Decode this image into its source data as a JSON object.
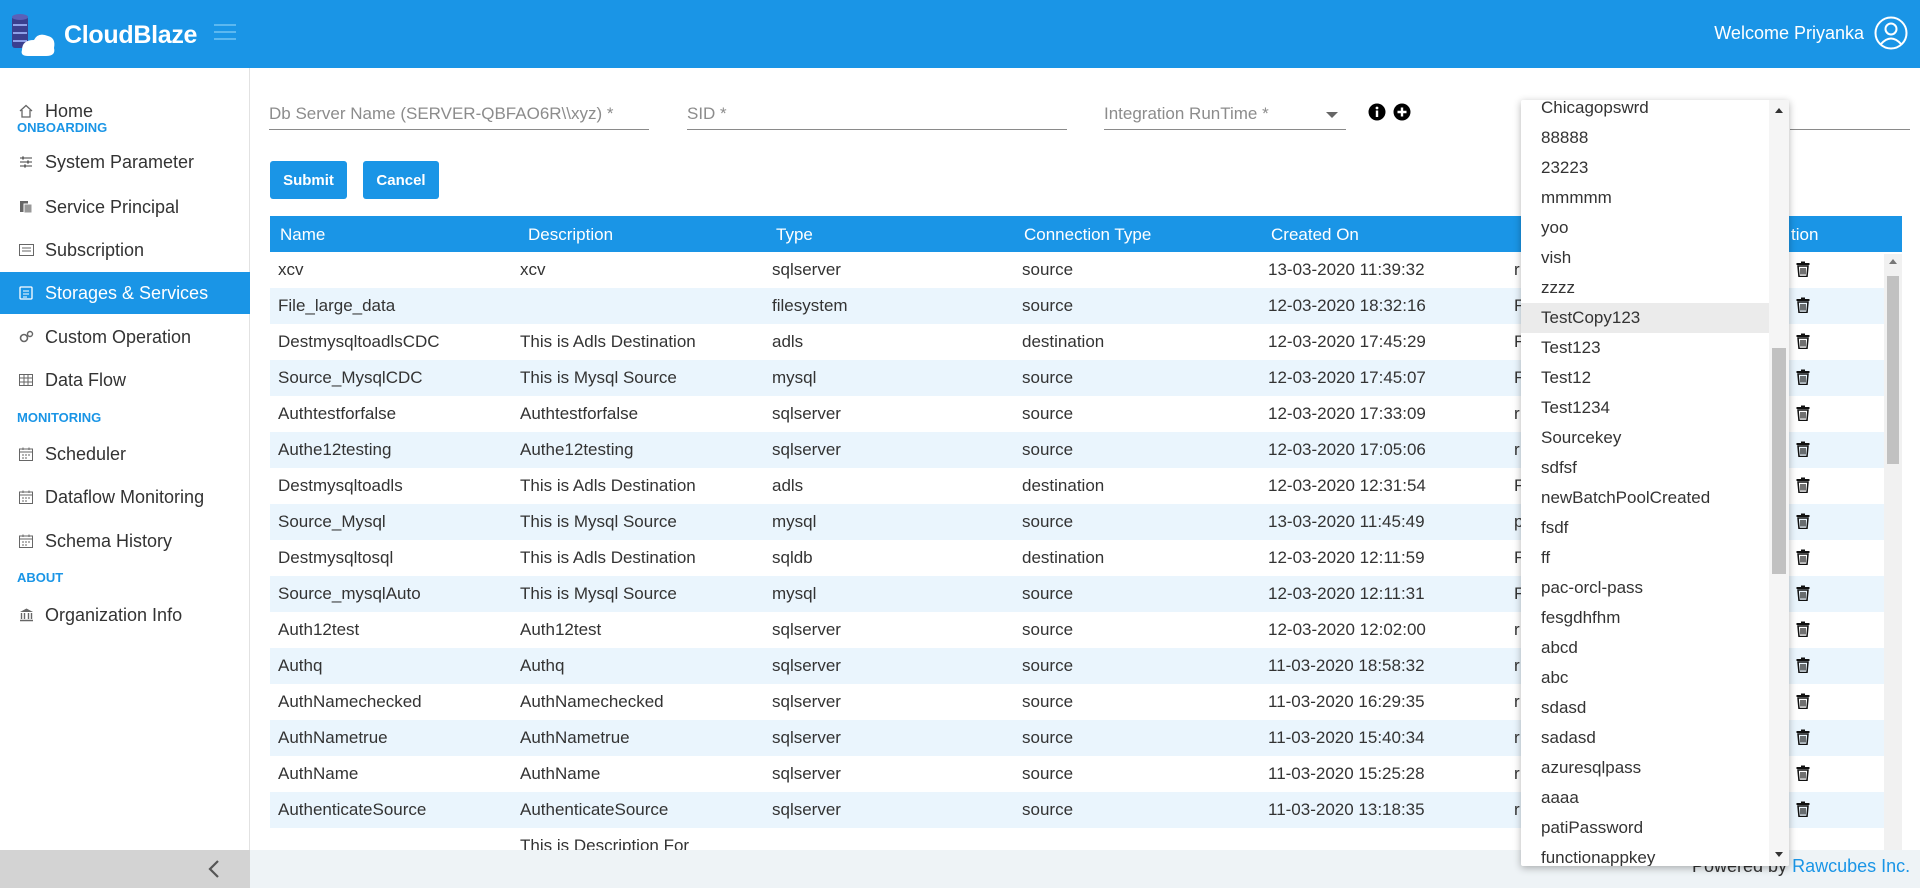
{
  "header": {
    "brand": "CloudBlaze",
    "welcome": "Welcome Priyanka"
  },
  "colors": {
    "accent": "#1a95e6",
    "row_alt": "#eaf5fd"
  },
  "sidebar": {
    "home": "Home",
    "onboarding": "ONBOARDING",
    "system_parameter": "System Parameter",
    "service_principal": "Service Principal",
    "subscription": "Subscription",
    "storages_services": "Storages & Services",
    "custom_operation": "Custom Operation",
    "data_flow": "Data Flow",
    "monitoring": "MONITORING",
    "scheduler": "Scheduler",
    "dataflow_monitoring": "Dataflow Monitoring",
    "schema_history": "Schema History",
    "about": "ABOUT",
    "organization_info": "Organization Info"
  },
  "form": {
    "server_placeholder": "Db Server Name (SERVER-QBFAO6R\\\\xyz) *",
    "sid_placeholder": "SID *",
    "runtime_placeholder": "Integration RunTime *",
    "submit": "Submit",
    "cancel": "Cancel"
  },
  "table": {
    "headers": {
      "name": "Name",
      "description": "Description",
      "type": "Type",
      "connection_type": "Connection Type",
      "created_on": "Created On",
      "action": "tion"
    },
    "rows": [
      {
        "name": "xcv",
        "description": "xcv",
        "type": "sqlserver",
        "conn": "source",
        "created": "13-03-2020 11:39:32",
        "extra": "r"
      },
      {
        "name": "File_large_data",
        "description": "",
        "type": "filesystem",
        "conn": "source",
        "created": "12-03-2020 18:32:16",
        "extra": "F"
      },
      {
        "name": "DestmysqltoadlsCDC",
        "description": "This is Adls Destination",
        "type": "adls",
        "conn": "destination",
        "created": "12-03-2020 17:45:29",
        "extra": "F"
      },
      {
        "name": "Source_MysqlCDC",
        "description": "This is Mysql Source",
        "type": "mysql",
        "conn": "source",
        "created": "12-03-2020 17:45:07",
        "extra": "F"
      },
      {
        "name": "Authtestforfalse",
        "description": "Authtestforfalse",
        "type": "sqlserver",
        "conn": "source",
        "created": "12-03-2020 17:33:09",
        "extra": "r"
      },
      {
        "name": "Authe12testing",
        "description": "Authe12testing",
        "type": "sqlserver",
        "conn": "source",
        "created": "12-03-2020 17:05:06",
        "extra": "r"
      },
      {
        "name": "Destmysqltoadls",
        "description": "This is Adls Destination",
        "type": "adls",
        "conn": "destination",
        "created": "12-03-2020 12:31:54",
        "extra": "F"
      },
      {
        "name": "Source_Mysql",
        "description": "This is Mysql Source",
        "type": "mysql",
        "conn": "source",
        "created": "13-03-2020 11:45:49",
        "extra": "p"
      },
      {
        "name": "Destmysqltosql",
        "description": "This is Adls Destination",
        "type": "sqldb",
        "conn": "destination",
        "created": "12-03-2020 12:11:59",
        "extra": "F"
      },
      {
        "name": "Source_mysqlAuto",
        "description": "This is Mysql Source",
        "type": "mysql",
        "conn": "source",
        "created": "12-03-2020 12:11:31",
        "extra": "F"
      },
      {
        "name": "Auth12test",
        "description": "Auth12test",
        "type": "sqlserver",
        "conn": "source",
        "created": "12-03-2020 12:02:00",
        "extra": "r"
      },
      {
        "name": "Authq",
        "description": "Authq",
        "type": "sqlserver",
        "conn": "source",
        "created": "11-03-2020 18:58:32",
        "extra": "r"
      },
      {
        "name": "AuthNamechecked",
        "description": "AuthNamechecked",
        "type": "sqlserver",
        "conn": "source",
        "created": "11-03-2020 16:29:35",
        "extra": "r"
      },
      {
        "name": "AuthNametrue",
        "description": "AuthNametrue",
        "type": "sqlserver",
        "conn": "source",
        "created": "11-03-2020 15:40:34",
        "extra": "r"
      },
      {
        "name": "AuthName",
        "description": "AuthName",
        "type": "sqlserver",
        "conn": "source",
        "created": "11-03-2020 15:25:28",
        "extra": "r"
      },
      {
        "name": "AuthenticateSource",
        "description": "AuthenticateSource",
        "type": "sqlserver",
        "conn": "source",
        "created": "11-03-2020 13:18:35",
        "extra": "r"
      },
      {
        "name": "",
        "description": "This is Description For",
        "type": "",
        "conn": "",
        "created": "",
        "extra": ""
      }
    ]
  },
  "dropdown": {
    "items": [
      "Chicagopswrd",
      "88888",
      "23223",
      "mmmmm",
      "yoo",
      "vish",
      "zzzz",
      "TestCopy123",
      "Test123",
      "Test12",
      "Test1234",
      "Sourcekey",
      "sdfsf",
      "newBatchPoolCreated",
      "fsdf",
      "ff",
      "pac-orcl-pass",
      "fesgdhfhm",
      "abcd",
      "abc",
      "sdasd",
      "sadasd",
      "azuresqlpass",
      "aaaa",
      "patiPassword",
      "functionappkey"
    ],
    "highlighted": "TestCopy123"
  },
  "footer": {
    "powered_by": "Powered by",
    "company": "Rawcubes Inc."
  }
}
